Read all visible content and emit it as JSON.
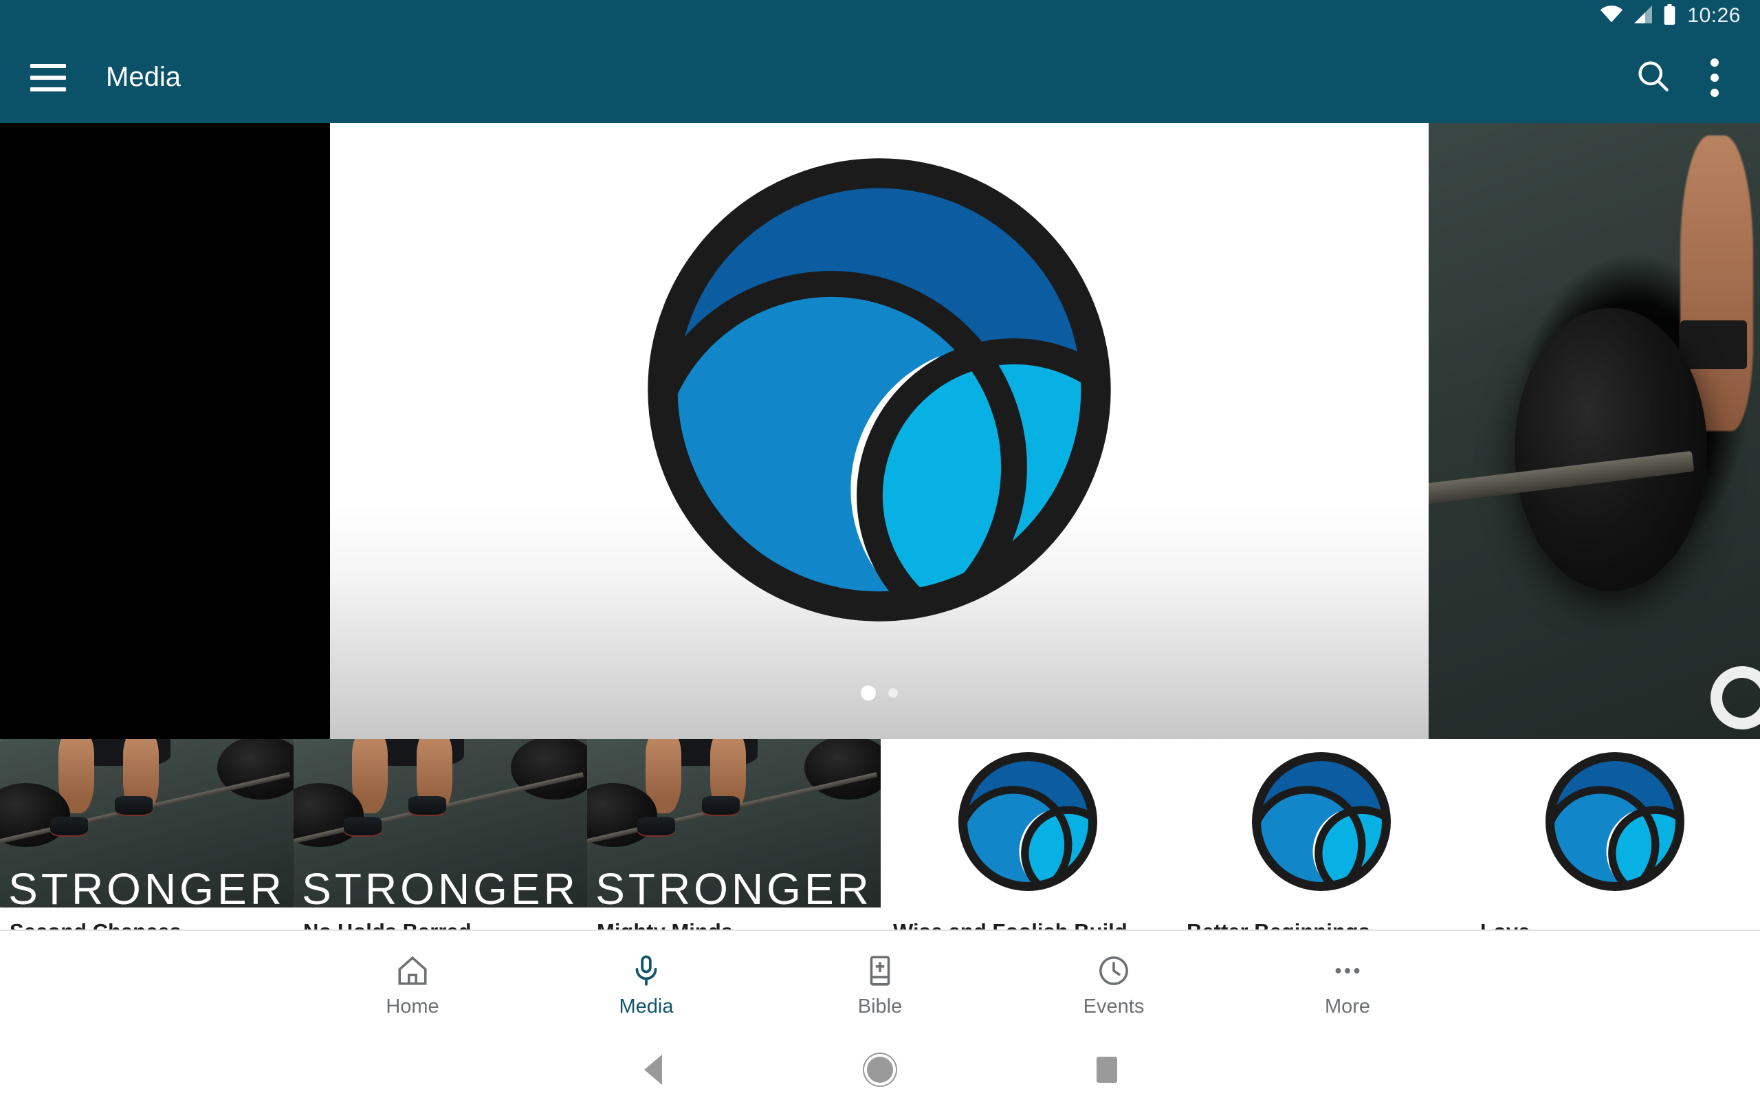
{
  "statusbar": {
    "time": "10:26",
    "icons": [
      "wifi-icon",
      "cellular-signal-icon",
      "battery-icon"
    ]
  },
  "appbar": {
    "title": "Media",
    "menu_icon": "hamburger-menu-icon",
    "search_icon": "search-icon",
    "overflow_icon": "overflow-menu-icon",
    "background_color": "#0b5269"
  },
  "carousel": {
    "slides": [
      {
        "type": "image",
        "label": "previous-slide",
        "style": "black"
      },
      {
        "type": "logo",
        "label": "featured-logo-slide"
      },
      {
        "type": "image",
        "label": "next-slide",
        "overlay_text": "O"
      }
    ],
    "pagination": {
      "count": 2,
      "active_index": 0
    }
  },
  "media_items": [
    {
      "title": "Second Chances",
      "thumb": "photo",
      "overlay_text": "STRONGER"
    },
    {
      "title": "No Holds Barred",
      "thumb": "photo",
      "overlay_text": "STRONGER"
    },
    {
      "title": "Mighty Minds",
      "thumb": "photo",
      "overlay_text": "STRONGER"
    },
    {
      "title": "Wise and Foolish Build",
      "thumb": "logo",
      "overlay_text": ""
    },
    {
      "title": "Better Beginnings",
      "thumb": "logo",
      "overlay_text": ""
    },
    {
      "title": "Love",
      "thumb": "logo",
      "overlay_text": ""
    }
  ],
  "bottom_nav": {
    "active_color": "#10556b",
    "inactive_color": "#6d7073",
    "items": [
      {
        "label": "Home",
        "icon": "home-icon",
        "active": false
      },
      {
        "label": "Media",
        "icon": "microphone-icon",
        "active": true
      },
      {
        "label": "Bible",
        "icon": "bible-book-icon",
        "active": false
      },
      {
        "label": "Events",
        "icon": "clock-icon",
        "active": false
      },
      {
        "label": "More",
        "icon": "more-dots-icon",
        "active": false
      }
    ]
  },
  "android_nav": {
    "back": "back-triangle-icon",
    "home": "home-circle-icon",
    "recents": "recents-square-icon"
  },
  "logo_colors": {
    "outline": "#1b1b1b",
    "dark_blue": "#0b5ca0",
    "mid_blue": "#1186c8",
    "light_blue": "#08b1e3",
    "white": "#ffffff"
  }
}
